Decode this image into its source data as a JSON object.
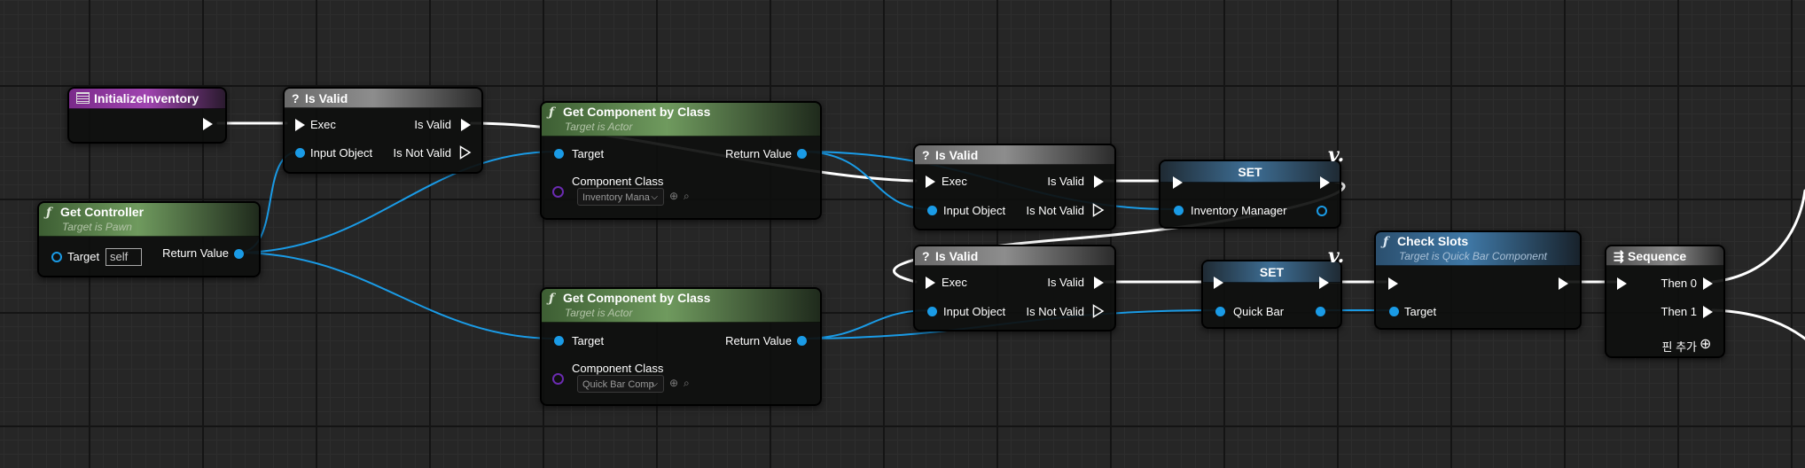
{
  "nodes": {
    "init": {
      "title": "InitializeInventory"
    },
    "isvalid1": {
      "title": "Is Valid",
      "exec": "Exec",
      "is_valid": "Is Valid",
      "input_object": "Input Object",
      "is_not_valid": "Is Not Valid"
    },
    "getcomp1": {
      "title": "Get Component by Class",
      "subtitle": "Target is Actor",
      "target": "Target",
      "return_value": "Return Value",
      "component_class": "Component Class",
      "class_value": "Inventory Mana"
    },
    "getcontroller": {
      "title": "Get Controller",
      "subtitle": "Target is Pawn",
      "target": "Target",
      "self": "self",
      "return_value": "Return Value"
    },
    "isvalid2": {
      "title": "Is Valid",
      "exec": "Exec",
      "is_valid": "Is Valid",
      "input_object": "Input Object",
      "is_not_valid": "Is Not Valid"
    },
    "set1": {
      "title": "SET",
      "var": "Inventory Manager"
    },
    "isvalid3": {
      "title": "Is Valid",
      "exec": "Exec",
      "is_valid": "Is Valid",
      "input_object": "Input Object",
      "is_not_valid": "Is Not Valid"
    },
    "set2": {
      "title": "SET",
      "var": "Quick Bar"
    },
    "checkslots": {
      "title": "Check Slots",
      "subtitle": "Target is Quick Bar Component",
      "target": "Target"
    },
    "sequence": {
      "title": "Sequence",
      "then0": "Then 0",
      "then1": "Then 1",
      "add_pin": "핀 추가"
    },
    "getcomp2": {
      "title": "Get Component by Class",
      "subtitle": "Target is Actor",
      "target": "Target",
      "return_value": "Return Value",
      "component_class": "Component Class",
      "class_value": "Quick Bar Comp"
    }
  },
  "icons": {
    "function": "function-icon",
    "macro": "question-icon",
    "event": "event-icon",
    "sequence": "sequence-icon",
    "variable": "variable-icon"
  },
  "colors": {
    "exec_wire": "#ffffff",
    "object_wire": "#1a9be6",
    "class_pin": "#6a2bb0",
    "event_header": "#a044b0",
    "function_header": "#6f9a5e",
    "member_function_header": "#3f78a6",
    "macro_header": "#8d8d8d"
  }
}
